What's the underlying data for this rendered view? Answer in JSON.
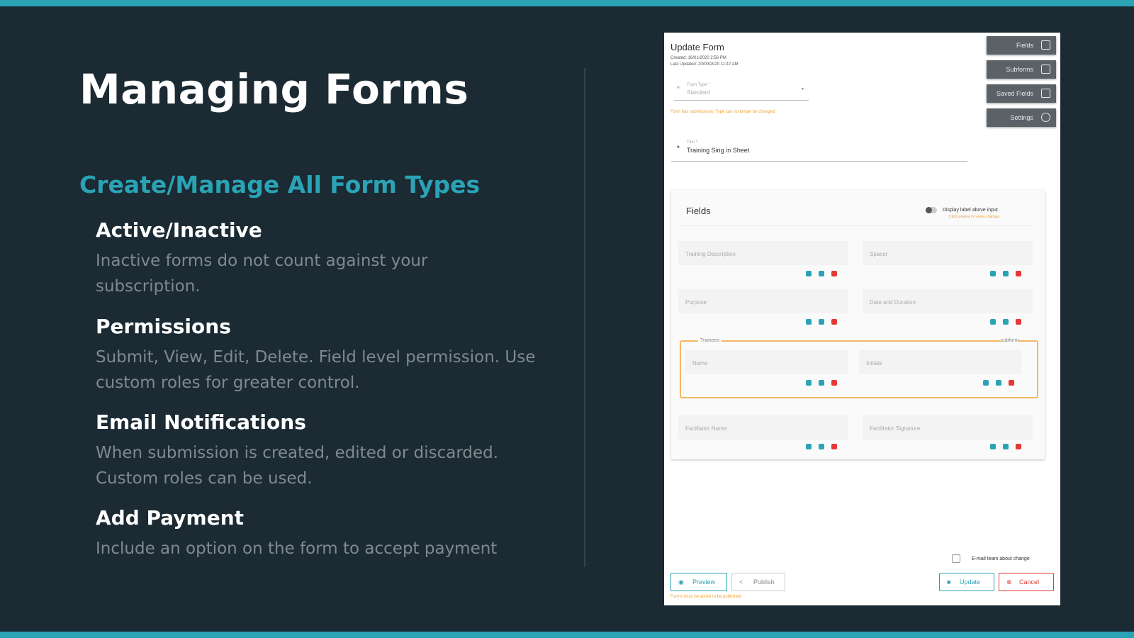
{
  "slide": {
    "title": "Managing Forms",
    "subtitle": "Create/Manage All Form Types",
    "sections": [
      {
        "heading": "Active/Inactive",
        "body": "Inactive forms do not count against your subscription."
      },
      {
        "heading": "Permissions",
        "body": "Submit, View, Edit, Delete. Field level permission. Use custom roles for greater control."
      },
      {
        "heading": "Email Notifications",
        "body": "When submission is created, edited or discarded. Custom roles can be used."
      },
      {
        "heading": "Add Payment",
        "body": "Include an option on the form to accept payment"
      }
    ]
  },
  "screenshot": {
    "form_title": "Update Form",
    "meta_created": "Created: 16/01/2020 2:56 PM",
    "meta_updated": "Last Updated: 20/09/2020 11:47 AM",
    "form_type_label": "Form Type *",
    "form_type_value": "Standard",
    "warning": "Form has submissions: Type can no longer be changed",
    "title_label": "Title *",
    "title_value": "Training Sing in Sheet",
    "side_buttons": [
      "Fields",
      "Subforms",
      "Saved Fields",
      "Settings"
    ],
    "fields_header": "Fields",
    "display_label_toggle": "Display label above input",
    "display_label_hint": "Click preview to review changes",
    "fields": [
      "Training Description",
      "Spacer",
      "Purpose",
      "Date and Duration"
    ],
    "subform_label": "Trainees",
    "subform_tag": "subform",
    "subform_fields": [
      "Name",
      "Initials"
    ],
    "bottom_fields": [
      "Facilitator Name",
      "Facilitator Signature"
    ],
    "email_checkbox": "E-mail team about change",
    "preview_button": "Preview",
    "publish_button": "Publish",
    "update_button": "Update",
    "cancel_button": "Cancel",
    "footer_note": "Forms must be active to be published",
    "colors": {
      "accent": "#2aa3b5",
      "warning": "#f0a030",
      "danger": "#e53935",
      "subform": "#f3b866"
    }
  }
}
